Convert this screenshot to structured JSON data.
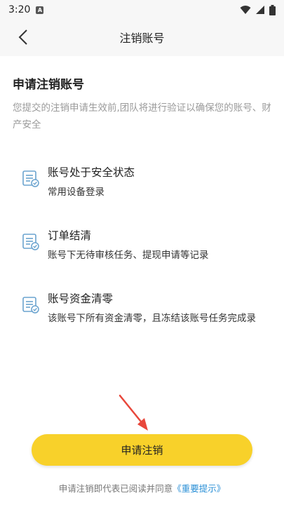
{
  "status_bar": {
    "time": "3:20",
    "notification_icon": "A"
  },
  "nav": {
    "title": "注销账号"
  },
  "section": {
    "title": "申请注销账号",
    "description": "您提交的注销申请生效前,团队将进行验证以确保您的账号、财产安全"
  },
  "conditions": [
    {
      "title": "账号处于安全状态",
      "subtitle": "常用设备登录",
      "icon": "security-check-icon"
    },
    {
      "title": "订单结清",
      "subtitle": "账号下无待审核任务、提现申请等记录",
      "icon": "order-check-icon"
    },
    {
      "title": "账号资金清零",
      "subtitle": "该账号下所有资金清零，且冻结该账号任务完成录",
      "icon": "funds-check-icon"
    }
  ],
  "button": {
    "label": "申请注销"
  },
  "agreement": {
    "prefix": "申请注销即代表已阅读并同意",
    "link": "《重要提示》"
  },
  "colors": {
    "accent": "#f8d12a",
    "link": "#2a8fd6",
    "arrow": "#e8473b",
    "icon": "#6aa3cf"
  }
}
